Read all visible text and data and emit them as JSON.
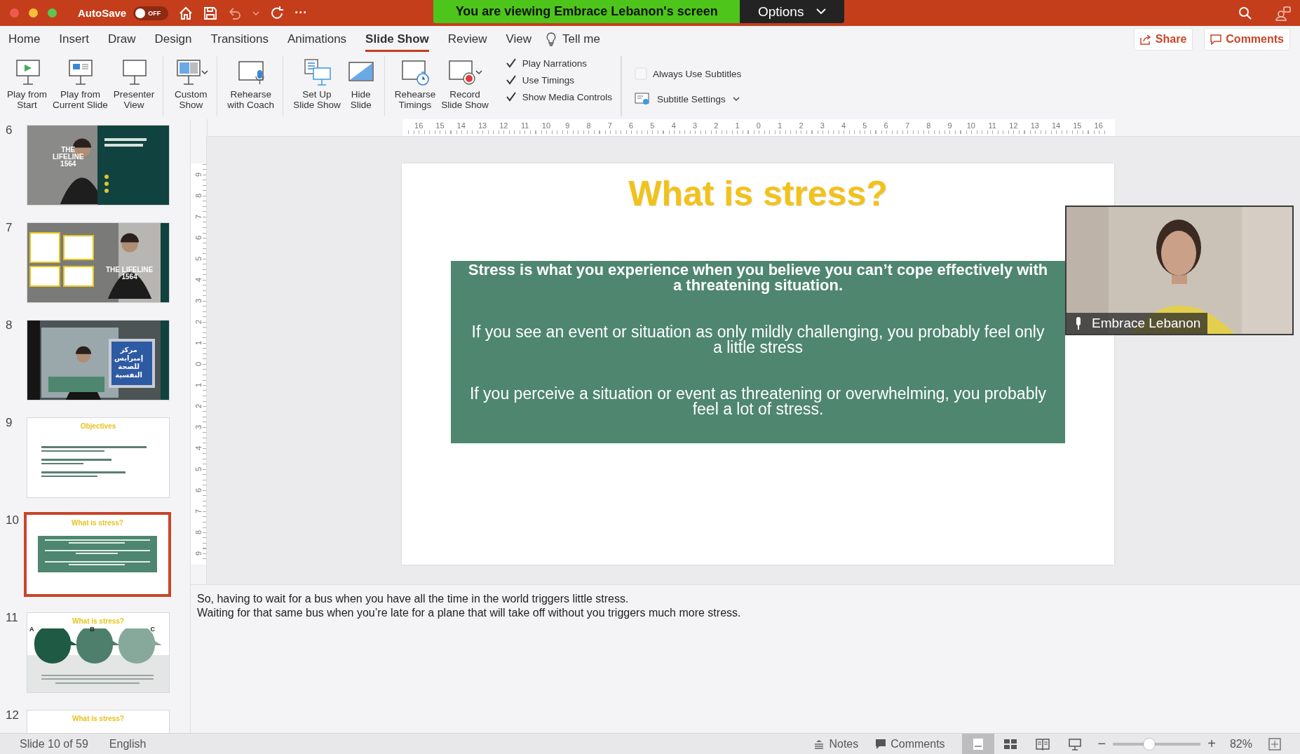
{
  "title_bar": {
    "autosave_label": "AutoSave",
    "autosave_state": "OFF",
    "autosave_on": false,
    "more": "···"
  },
  "share_banner": {
    "message": "You are viewing Embrace Lebanon's screen",
    "options": "Options"
  },
  "tabs": [
    {
      "label": "Home",
      "selected": false
    },
    {
      "label": "Insert",
      "selected": false
    },
    {
      "label": "Draw",
      "selected": false
    },
    {
      "label": "Design",
      "selected": false
    },
    {
      "label": "Transitions",
      "selected": false
    },
    {
      "label": "Animations",
      "selected": false
    },
    {
      "label": "Slide Show",
      "selected": true
    },
    {
      "label": "Review",
      "selected": false
    },
    {
      "label": "View",
      "selected": false
    }
  ],
  "tell_me": "Tell me",
  "share_button": "Share",
  "comments_button": "Comments",
  "ribbon": {
    "groups": [
      [
        {
          "label": "Play from\nStart",
          "kind": "start"
        },
        {
          "label": "Play from\nCurrent Slide",
          "kind": "current"
        },
        {
          "label": "Presenter\nView",
          "kind": "presenter"
        }
      ],
      [
        {
          "label": "Custom\nShow",
          "kind": "custom"
        }
      ],
      [
        {
          "label": "Rehearse\nwith Coach",
          "kind": "coach"
        }
      ],
      [
        {
          "label": "Set Up\nSlide Show",
          "kind": "setup"
        },
        {
          "label": "Hide\nSlide",
          "kind": "hide"
        }
      ],
      [
        {
          "label": "Rehearse\nTimings",
          "kind": "timings"
        },
        {
          "label": "Record\nSlide Show",
          "kind": "record"
        }
      ]
    ],
    "checkboxes": [
      {
        "label": "Play Narrations",
        "checked": true
      },
      {
        "label": "Use Timings",
        "checked": true
      },
      {
        "label": "Show Media Controls",
        "checked": true
      }
    ],
    "subtitles_checkbox": {
      "label": "Always Use Subtitles",
      "checked": false
    },
    "subtitle_settings": "Subtitle Settings"
  },
  "thumbnails": [
    {
      "number": "6",
      "kind": "photo-panel",
      "selected": false,
      "captions": [
        "THE",
        "LIFELINE",
        "1564"
      ]
    },
    {
      "number": "7",
      "kind": "photo-callouts",
      "selected": false,
      "captions": [
        "THE LIFELINE",
        "1564"
      ]
    },
    {
      "number": "8",
      "kind": "photo-poster",
      "selected": false,
      "captions": [
        "مركز",
        "إمبرايس",
        "للصحة",
        "النفسية"
      ]
    },
    {
      "number": "9",
      "kind": "bullets",
      "selected": false,
      "captions": [
        "Objectives"
      ]
    },
    {
      "number": "10",
      "kind": "green-box",
      "selected": true,
      "captions": [
        "What is stress?"
      ]
    },
    {
      "number": "11",
      "kind": "drops",
      "selected": false,
      "captions": [
        "What is stress?",
        "A",
        "B",
        "C"
      ]
    },
    {
      "number": "12",
      "kind": "blank",
      "selected": false,
      "captions": [
        "What is stress?"
      ]
    }
  ],
  "ruler": {
    "horizontal": [
      "16",
      "15",
      "14",
      "13",
      "12",
      "11",
      "10",
      "9",
      "8",
      "7",
      "6",
      "5",
      "4",
      "3",
      "2",
      "1",
      "0",
      "1",
      "2",
      "3",
      "4",
      "5",
      "6",
      "7",
      "8",
      "9",
      "10",
      "11",
      "12",
      "13",
      "14",
      "15",
      "16"
    ],
    "vertical": [
      "9",
      "8",
      "7",
      "6",
      "5",
      "4",
      "3",
      "2",
      "1",
      "0",
      "1",
      "2",
      "3",
      "4",
      "5",
      "6",
      "7",
      "8",
      "9"
    ]
  },
  "slide": {
    "title": "What is stress?",
    "paragraphs": [
      {
        "text": "Stress is what you experience when you believe you can’t cope effectively with a threatening situation.",
        "bold": true
      },
      {
        "text": "If you see an event or situation as only mildly challenging, you probably feel only a little stress",
        "bold": false
      },
      {
        "text": "If you perceive a situation or event as threatening or overwhelming, you probably feel a lot of stress.",
        "bold": false
      }
    ]
  },
  "video": {
    "name": "Embrace Lebanon"
  },
  "notes": [
    "So, having to wait for a bus when you have all the time in the world triggers little stress.",
    "Waiting for that same bus when you’re late for a plane that will take off without you triggers much more stress."
  ],
  "status_bar": {
    "slide": "Slide 10 of 59",
    "language": "English",
    "notes": "Notes",
    "comments": "Comments",
    "views": [
      {
        "kind": "normal",
        "selected": true
      },
      {
        "kind": "sorter",
        "selected": false
      },
      {
        "kind": "reading",
        "selected": false
      },
      {
        "kind": "slideshow",
        "selected": false
      }
    ],
    "zoom_out": "−",
    "zoom_in": "+",
    "zoom_slider": {
      "level": 0.41
    },
    "zoom": "82%"
  }
}
